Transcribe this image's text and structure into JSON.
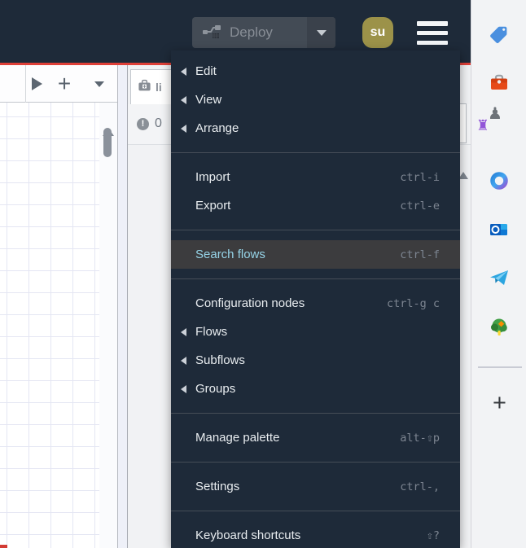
{
  "header": {
    "deploy_label": "Deploy",
    "user_initials": "su"
  },
  "menu": {
    "items": [
      {
        "id": "edit",
        "label": "Edit",
        "submenu": true
      },
      {
        "id": "view",
        "label": "View",
        "submenu": true
      },
      {
        "id": "arrange",
        "label": "Arrange",
        "submenu": true
      },
      {
        "type": "separator"
      },
      {
        "id": "import",
        "label": "Import",
        "shortcut": "ctrl-i"
      },
      {
        "id": "export",
        "label": "Export",
        "shortcut": "ctrl-e"
      },
      {
        "type": "separator"
      },
      {
        "id": "search-flows",
        "label": "Search flows",
        "shortcut": "ctrl-f",
        "highlighted": true
      },
      {
        "type": "separator"
      },
      {
        "id": "configuration-nodes",
        "label": "Configuration nodes",
        "shortcut": "ctrl-g c"
      },
      {
        "id": "flows",
        "label": "Flows",
        "submenu": true
      },
      {
        "id": "subflows",
        "label": "Subflows",
        "submenu": true
      },
      {
        "id": "groups",
        "label": "Groups",
        "submenu": true
      },
      {
        "type": "separator"
      },
      {
        "id": "manage-palette",
        "label": "Manage palette",
        "shortcut": "alt-⇧p"
      },
      {
        "type": "separator"
      },
      {
        "id": "settings",
        "label": "Settings",
        "shortcut": "ctrl-,"
      },
      {
        "type": "separator"
      },
      {
        "id": "keyboard-shortcuts",
        "label": "Keyboard shortcuts",
        "shortcut": "⇧?"
      }
    ]
  },
  "workspace": {
    "lint_tab_label": "li",
    "issue_count": "0"
  },
  "browser_strip": {
    "tabs": [
      {
        "id": "price-tag",
        "icon": "tag"
      },
      {
        "id": "toolbox",
        "icon": "toolbox"
      },
      {
        "id": "chess",
        "icon": "chess"
      },
      {
        "id": "loop",
        "icon": "loop"
      },
      {
        "id": "outlook",
        "icon": "outlook"
      },
      {
        "id": "telegram",
        "icon": "telegram"
      },
      {
        "id": "tree",
        "icon": "tree"
      }
    ],
    "new_tab_label": "+"
  },
  "colors": {
    "header_bg": "#1e2a39",
    "accent_red": "#df4038",
    "menu_bg": "#1e2a39",
    "menu_highlight_bg": "#3c3c3e",
    "menu_highlight_text": "#96d4e8",
    "avatar_bg": "#9c9249"
  }
}
